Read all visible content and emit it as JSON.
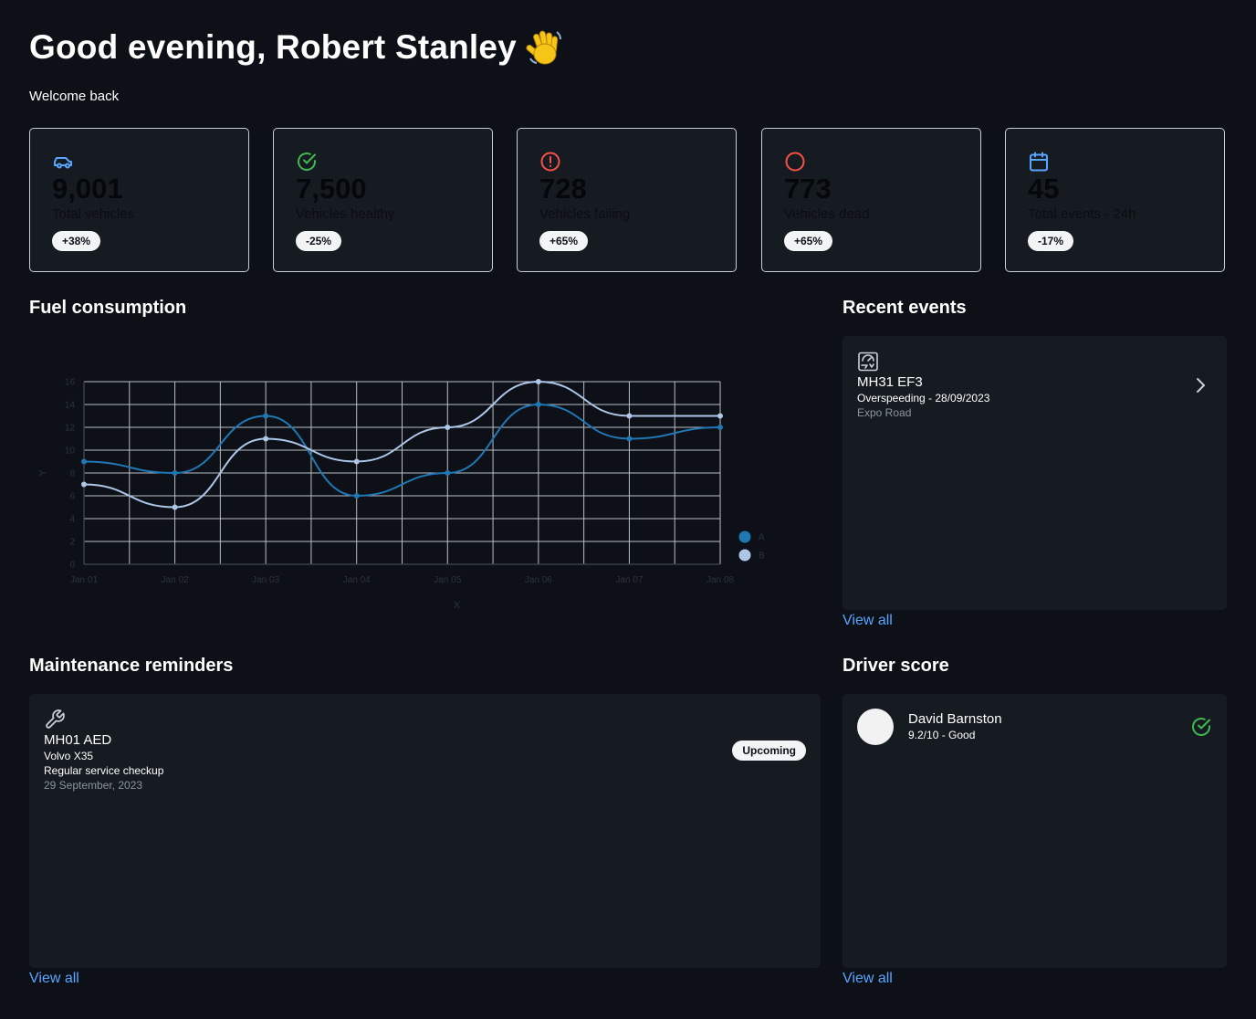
{
  "header": {
    "greeting": "Good evening, Robert Stanley",
    "subtitle": "Welcome back"
  },
  "stats": [
    {
      "value": "9,001",
      "label": "Total vehicles",
      "change": "+38%",
      "icon": "car-icon",
      "color": "#58a6ff"
    },
    {
      "value": "7,500",
      "label": "Vehicles healthy",
      "change": "-25%",
      "icon": "check-circle-icon",
      "color": "#3fb950"
    },
    {
      "value": "728",
      "label": "Vehicles failing",
      "change": "+65%",
      "icon": "alert-circle-icon",
      "color": "#f85149"
    },
    {
      "value": "773",
      "label": "Vehicles dead",
      "change": "+65%",
      "icon": "circle-icon",
      "color": "#f85149"
    },
    {
      "value": "45",
      "label": "Total events - 24h",
      "change": "-17%",
      "icon": "calendar-icon",
      "color": "#58a6ff"
    }
  ],
  "fuel": {
    "title": "Fuel consumption"
  },
  "chart_data": {
    "type": "line",
    "title": "",
    "xlabel": "X",
    "ylabel": "Y",
    "categories": [
      "Jan 01",
      "Jan 02",
      "Jan 03",
      "Jan 04",
      "Jan 05",
      "Jan 06",
      "Jan 07",
      "Jan 08"
    ],
    "ylim": [
      0,
      16
    ],
    "yticks": [
      0,
      2,
      4,
      6,
      8,
      10,
      12,
      14,
      16
    ],
    "grid": true,
    "legend": "right",
    "series": [
      {
        "name": "A",
        "color": "#1f77b4",
        "values": [
          9,
          8,
          13,
          6,
          8,
          14,
          11,
          12
        ]
      },
      {
        "name": "B",
        "color": "#aec7e8",
        "values": [
          7,
          5,
          11,
          9,
          12,
          16,
          13,
          13
        ]
      }
    ]
  },
  "events": {
    "title": "Recent events",
    "item": {
      "plate": "MH31 EF3",
      "detail": "Overspeeding - 28/09/2023",
      "location": "Expo Road",
      "icon": "speed-event-icon"
    },
    "view_all": "View all"
  },
  "maintenance": {
    "title": "Maintenance reminders",
    "item": {
      "plate": "MH01 AED",
      "model": "Volvo X35",
      "task": "Regular service checkup",
      "date": "29 September, 2023",
      "badge": "Upcoming",
      "icon": "wrench-icon"
    },
    "view_all": "View all"
  },
  "driver": {
    "title": "Driver score",
    "item": {
      "name": "David Barnston",
      "score": "9.2/10 - Good",
      "icon": "check-circle-icon",
      "color": "#3fb950"
    },
    "view_all": "View all"
  },
  "colors": {
    "background": "#0d1117",
    "panel": "#161b22",
    "link": "#58a6ff"
  }
}
